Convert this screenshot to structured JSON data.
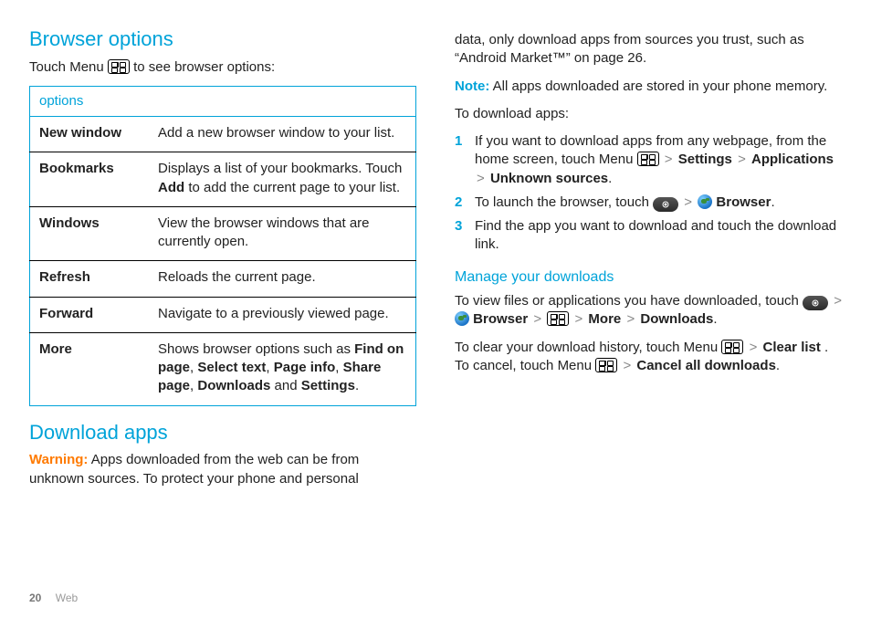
{
  "footer": {
    "page": "20",
    "section": "Web"
  },
  "left": {
    "heading": "Browser options",
    "intro_pre": "Touch Menu ",
    "intro_post": " to see browser options:",
    "table_header": "options",
    "rows": [
      {
        "k": "New window",
        "v_plain": "Add a new browser window to your list."
      },
      {
        "k": "Bookmarks",
        "v_pre": "Displays a list of your bookmarks. Touch ",
        "v_b": "Add",
        "v_post": " to add the current page to your list."
      },
      {
        "k": "Windows",
        "v_plain": "View the browser windows that are currently open."
      },
      {
        "k": "Refresh",
        "v_plain": "Reloads the current page."
      },
      {
        "k": "Forward",
        "v_plain": "Navigate to a previously viewed page."
      },
      {
        "k": "More",
        "v_pre": "Shows browser options such as ",
        "v_b": "Find on page",
        "v_mid1": ", ",
        "v_b2": "Select text",
        "v_mid2": ", ",
        "v_b3": "Page info",
        "v_mid3": ", ",
        "v_b4": "Share page",
        "v_mid4": ", ",
        "v_b5": "Downloads",
        "v_mid5": " and ",
        "v_b6": "Settings",
        "v_post": "."
      }
    ],
    "dl_heading": "Download apps",
    "dl_warn_label": "Warning:",
    "dl_warn_text": " Apps downloaded from the web can be from unknown sources. To protect your phone and personal"
  },
  "right": {
    "cont": "data, only download apps from sources you trust, such as “Android Market™” on page 26.",
    "note_label": "Note:",
    "note_text": " All apps downloaded are stored in your phone memory.",
    "to_dl": "To download apps:",
    "steps": [
      {
        "n": "1",
        "pre": "If you want to download apps from any webpage, from the home screen, touch Menu ",
        "seq": [
          " > ",
          "Settings",
          " > ",
          "Applications",
          " > ",
          "Unknown sources",
          "."
        ]
      },
      {
        "n": "2",
        "pre": "To launch the browser, touch ",
        "tail": "Browser",
        "post": "."
      },
      {
        "n": "3",
        "plain": "Find the app you want to download and touch the download link."
      }
    ],
    "mg_heading": "Manage your downloads",
    "mg_p1_pre": "To view files or applications you have downloaded, touch ",
    "mg_p1_b1": "Browser",
    "mg_p1_b2": "More",
    "mg_p1_b3": "Downloads",
    "mg_p2_pre": "To clear your download history, touch Menu ",
    "mg_p2_b1": "Clear list",
    "mg_p2_mid": ". To cancel, touch Menu ",
    "mg_p2_b2": "Cancel all downloads",
    "mg_p2_post": "."
  }
}
